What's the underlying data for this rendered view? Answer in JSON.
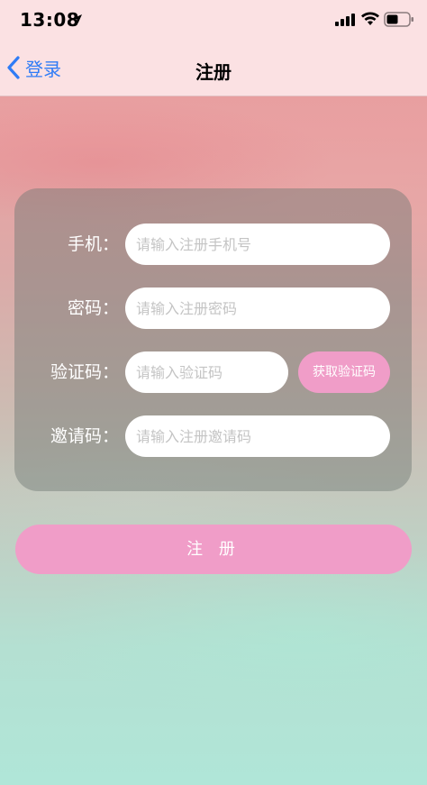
{
  "status_bar": {
    "time": "13:08",
    "icons": [
      "location-arrow-icon",
      "cellular-signal-icon",
      "wifi-icon",
      "battery-icon"
    ]
  },
  "nav": {
    "back_label": "登录",
    "title": "注册",
    "back_icon": "chevron-left-icon",
    "accent_color": "#2f7cf6"
  },
  "form": {
    "fields": [
      {
        "label": "手机：",
        "placeholder": "请输入注册手机号",
        "value": ""
      },
      {
        "label": "密码：",
        "placeholder": "请输入注册密码",
        "value": ""
      },
      {
        "label": "验证码：",
        "placeholder": "请输入验证码",
        "value": ""
      },
      {
        "label": "邀请码：",
        "placeholder": "请输入注册邀请码",
        "value": ""
      }
    ],
    "get_code_label": "获取验证码"
  },
  "actions": {
    "register_label": "注 册"
  },
  "colors": {
    "button": "#f09dc8",
    "header": "#fbe1e3",
    "label_text": "#ffffff"
  }
}
